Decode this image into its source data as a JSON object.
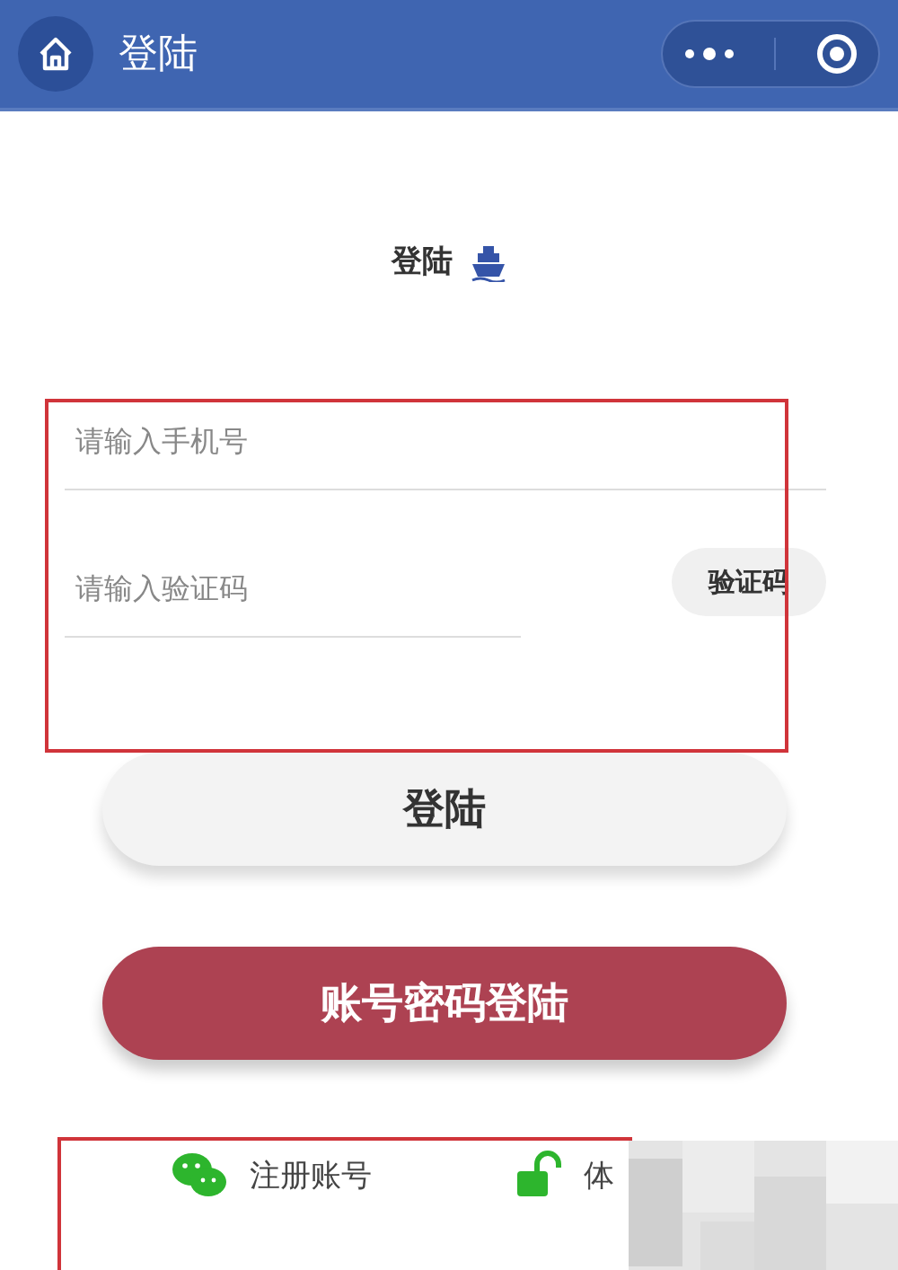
{
  "nav_bar": {
    "title": "登陆"
  },
  "heading": {
    "title": "登陆"
  },
  "form": {
    "phone_field": {
      "placeholder": "请输入手机号"
    },
    "code_field": {
      "placeholder": "请输入验证码"
    },
    "code_button": "验证码"
  },
  "login_button": "登陆",
  "password_login_button": "账号密码登陆",
  "footer_links": [
    {
      "kind": "wechat",
      "label": "注册账号"
    },
    {
      "kind": "lock",
      "label": "体"
    }
  ],
  "annotations": [
    {
      "kind": "frame",
      "color": "#d0343a"
    },
    {
      "kind": "frame",
      "color": "#d0343a"
    }
  ]
}
